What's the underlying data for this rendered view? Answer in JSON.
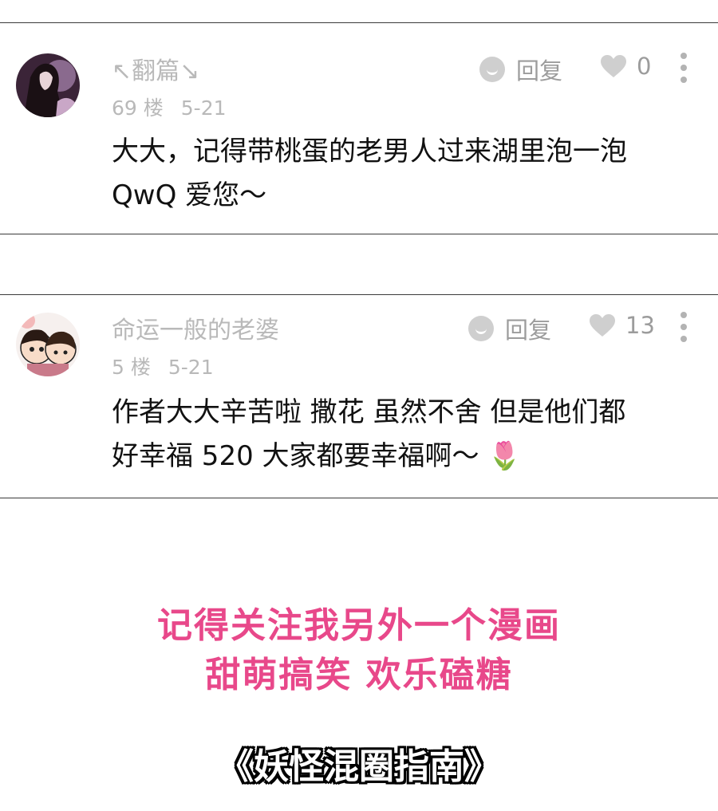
{
  "comments": [
    {
      "username": "↖翻篇↘",
      "floor": "69 楼",
      "date": "5-21",
      "reply_label": "回复",
      "likes": "0",
      "text_line1": "大大，记得带桃蛋的老男人过来湖里泡一泡",
      "text_line2": "QwQ 爱您～"
    },
    {
      "username": "命运一般的老婆",
      "floor": "5 楼",
      "date": "5-21",
      "reply_label": "回复",
      "likes": "13",
      "text_line1": "作者大大辛苦啦 撒花 虽然不舍 但是他们都",
      "text_line2": "好幸福 520 大家都要幸福啊～ 🌷"
    }
  ],
  "promo": {
    "line1": "记得关注我另外一个漫画",
    "line2": "甜萌搞笑  欢乐磕糖",
    "manga_title": "《妖怪混圈指南》"
  },
  "colors": {
    "promo_pink": "#e8488a",
    "meta_gray": "#b9b9b9",
    "icon_gray": "#cfcfcf"
  }
}
